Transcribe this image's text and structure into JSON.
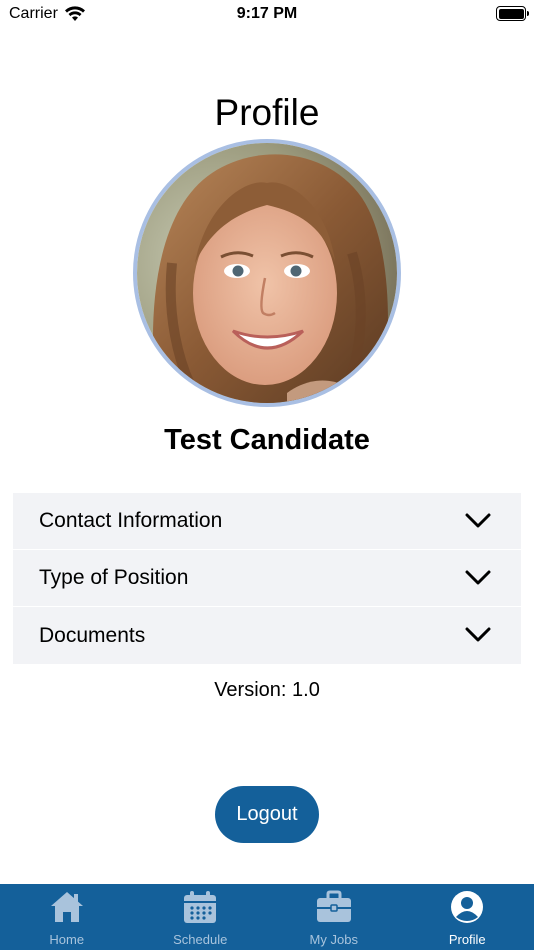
{
  "status_bar": {
    "carrier": "Carrier",
    "time": "9:17 PM",
    "battery_level": 1.0
  },
  "page": {
    "title": "Profile"
  },
  "profile": {
    "name": "Test Candidate",
    "avatar_icon": "user-photo"
  },
  "sections": [
    {
      "label": "Contact Information",
      "icon": "chevron-down-icon"
    },
    {
      "label": "Type of Position",
      "icon": "chevron-down-icon"
    },
    {
      "label": "Documents",
      "icon": "chevron-down-icon"
    }
  ],
  "version": {
    "text": "Version: 1.0"
  },
  "actions": {
    "logout_label": "Logout"
  },
  "tab_bar": {
    "active": "Profile",
    "tabs": [
      {
        "label": "Home",
        "icon": "home-icon"
      },
      {
        "label": "Schedule",
        "icon": "calendar-icon"
      },
      {
        "label": "My Jobs",
        "icon": "briefcase-icon"
      },
      {
        "label": "Profile",
        "icon": "user-circle-icon"
      }
    ]
  },
  "colors": {
    "accent": "#14609a",
    "tab_inactive_icon": "#a9c3dc",
    "section_background": "#f2f3f6",
    "avatar_border": "#a9bfe3"
  }
}
